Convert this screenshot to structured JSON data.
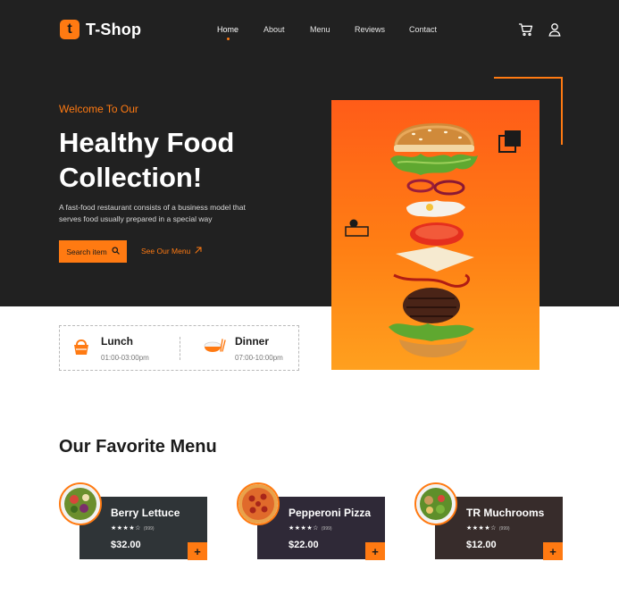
{
  "brand": {
    "logo_letter": "t",
    "name": "T-Shop",
    "accent": "#ff7a12",
    "dark": "#212121"
  },
  "nav": {
    "items": [
      {
        "label": "Home",
        "active": true
      },
      {
        "label": "About",
        "active": false
      },
      {
        "label": "Menu",
        "active": false
      },
      {
        "label": "Reviews",
        "active": false
      },
      {
        "label": "Contact",
        "active": false
      }
    ]
  },
  "header_icons": [
    "cart-icon",
    "user-icon"
  ],
  "hero": {
    "welcome": "Welcome To Our",
    "headline_line1": "Healthy Food",
    "headline_line2": "Collection!",
    "description": "A fast-food restaurant consists of a business model that serves food usually prepared in a special way",
    "search_button": "Search item",
    "menu_link": "See Our Menu"
  },
  "hours": [
    {
      "title": "Lunch",
      "time": "01:00-03:00pm",
      "icon": "lunch-box-icon"
    },
    {
      "title": "Dinner",
      "time": "07:00-10:00pm",
      "icon": "rice-bowl-icon"
    }
  ],
  "menu_section": {
    "title": "Our Favorite Menu",
    "items": [
      {
        "name": "Berry Lettuce",
        "stars": "★★★★☆",
        "count": "(999)",
        "price": "$32.00",
        "color": "#2f3437",
        "icon": "salad-bowl-icon"
      },
      {
        "name": "Pepperoni Pizza",
        "stars": "★★★★☆",
        "count": "(999)",
        "price": "$22.00",
        "color": "#2f2937",
        "icon": "pizza-icon"
      },
      {
        "name": "TR Muchrooms",
        "stars": "★★★★☆",
        "count": "(999)",
        "price": "$12.00",
        "color": "#372c2b",
        "icon": "salad-bowl-icon"
      }
    ]
  }
}
